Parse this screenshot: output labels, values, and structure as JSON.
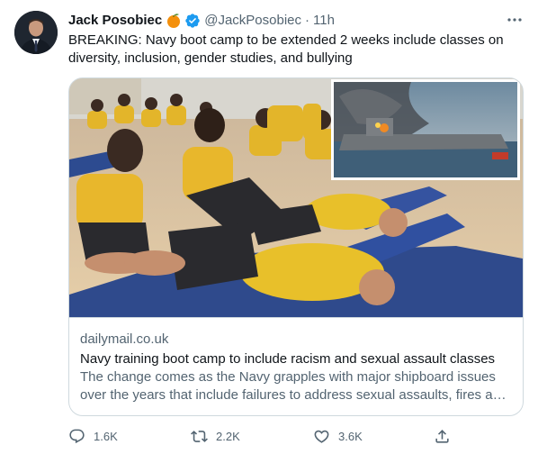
{
  "tweet": {
    "author_name": "Jack Posobiec",
    "author_emoji": "orange-icon",
    "verified_icon": "verified-badge-icon",
    "handle": "@JackPosobiec",
    "separator": "·",
    "time": "11h",
    "more_icon": "more-horizontal-icon",
    "text": "BREAKING: Navy boot camp to be extended 2 weeks include classes on diversity, inclusion, gender studies, and bullying"
  },
  "card": {
    "domain": "dailymail.co.uk",
    "title": "Navy training boot camp to include racism and sexual assault classes",
    "description": "The change comes as the Navy grapples with major shipboard issues over the years that include failures to address sexual assaults, fires and other problems."
  },
  "actions": {
    "reply": {
      "icon": "reply-icon",
      "count": "1.6K"
    },
    "retweet": {
      "icon": "retweet-icon",
      "count": "2.2K"
    },
    "like": {
      "icon": "heart-icon",
      "count": "3.6K"
    },
    "share": {
      "icon": "share-icon"
    }
  },
  "colors": {
    "text_primary": "#0f1419",
    "text_secondary": "#536471",
    "verified_blue": "#1d9bf0",
    "border": "#cfd9de"
  }
}
